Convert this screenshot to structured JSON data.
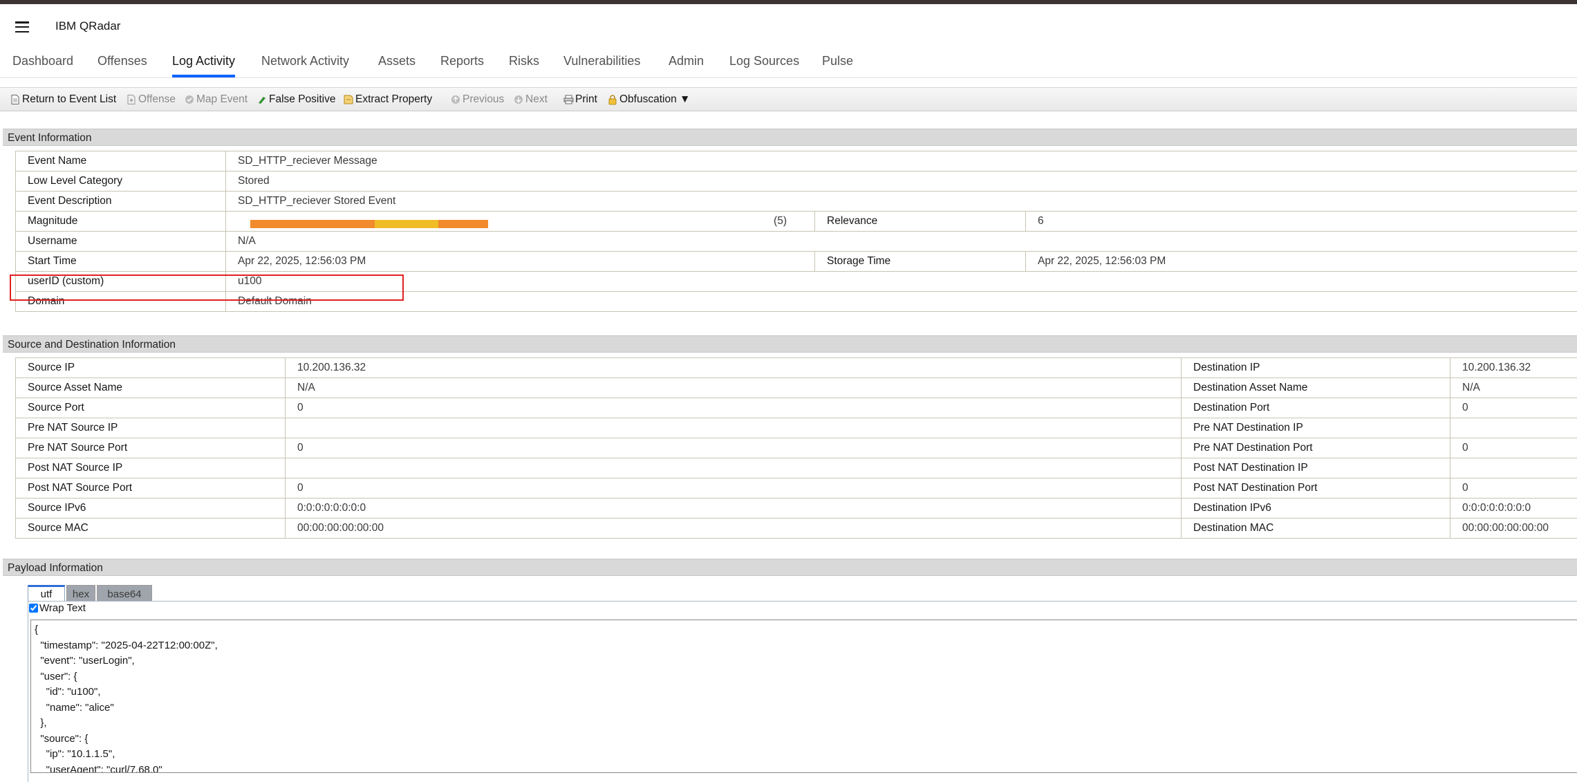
{
  "header": {
    "brand": "IBM QRadar"
  },
  "nav": {
    "tabs": [
      {
        "label": "Dashboard"
      },
      {
        "label": "Offenses"
      },
      {
        "label": "Log Activity"
      },
      {
        "label": "Network Activity"
      },
      {
        "label": "Assets"
      },
      {
        "label": "Reports"
      },
      {
        "label": "Risks"
      },
      {
        "label": "Vulnerabilities"
      },
      {
        "label": "Admin"
      },
      {
        "label": "Log Sources"
      },
      {
        "label": "Pulse"
      }
    ],
    "active": "Log Activity"
  },
  "toolbar": {
    "return_label": "Return to Event List",
    "offense_label": "Offense",
    "map_event_label": "Map Event",
    "false_positive_label": "False Positive",
    "extract_property_label": "Extract Property",
    "previous_label": "Previous",
    "next_label": "Next",
    "print_label": "Print",
    "obfuscation_label": "Obfuscation ▼"
  },
  "event_info": {
    "title": "Event Information",
    "event_name_label": "Event Name",
    "event_name": "SD_HTTP_reciever Message",
    "low_level_category_label": "Low Level Category",
    "low_level_category": "Stored",
    "event_description_label": "Event Description",
    "event_description": "SD_HTTP_reciever Stored Event",
    "magnitude_label": "Magnitude",
    "magnitude": "(5)",
    "relevance_label": "Relevance",
    "relevance": "6",
    "username_label": "Username",
    "username": "N/A",
    "start_time_label": "Start Time",
    "start_time": "Apr 22, 2025, 12:56:03 PM",
    "storage_time_label": "Storage Time",
    "storage_time": "Apr 22, 2025, 12:56:03 PM",
    "userid_label": "userID (custom)",
    "userid": "u100",
    "domain_label": "Domain",
    "domain": "Default Domain"
  },
  "source_dest": {
    "title": "Source and Destination Information",
    "source_ip_label": "Source IP",
    "source_ip": "10.200.136.32",
    "dest_ip_label": "Destination IP",
    "dest_ip": "10.200.136.32",
    "source_asset_label": "Source Asset Name",
    "source_asset": "N/A",
    "dest_asset_label": "Destination Asset Name",
    "dest_asset": "N/A",
    "source_port_label": "Source Port",
    "source_port": "0",
    "dest_port_label": "Destination Port",
    "dest_port": "0",
    "pre_nat_src_ip_label": "Pre NAT Source IP",
    "pre_nat_src_ip": "",
    "pre_nat_dst_ip_label": "Pre NAT Destination IP",
    "pre_nat_dst_ip": "",
    "pre_nat_src_port_label": "Pre NAT Source Port",
    "pre_nat_src_port": "0",
    "pre_nat_dst_port_label": "Pre NAT Destination Port",
    "pre_nat_dst_port": "0",
    "post_nat_src_ip_label": "Post NAT Source IP",
    "post_nat_src_ip": "",
    "post_nat_dst_ip_label": "Post NAT Destination IP",
    "post_nat_dst_ip": "",
    "post_nat_src_port_label": "Post NAT Source Port",
    "post_nat_src_port": "0",
    "post_nat_dst_port_label": "Post NAT Destination Port",
    "post_nat_dst_port": "0",
    "source_ipv6_label": "Source IPv6",
    "source_ipv6": "0:0:0:0:0:0:0:0",
    "dest_ipv6_label": "Destination IPv6",
    "dest_ipv6": "0:0:0:0:0:0:0:0",
    "source_mac_label": "Source MAC",
    "source_mac": "00:00:00:00:00:00",
    "dest_mac_label": "Destination MAC",
    "dest_mac": "00:00:00:00:00:00"
  },
  "payload": {
    "title": "Payload Information",
    "tabs": [
      {
        "label": "utf"
      },
      {
        "label": "hex"
      },
      {
        "label": "base64"
      }
    ],
    "active_tab": "utf",
    "wrap_text_label": "Wrap Text",
    "wrap_text_checked": true,
    "content": "{\n  \"timestamp\": \"2025-04-22T12:00:00Z\",\n  \"event\": \"userLogin\",\n  \"user\": {\n    \"id\": \"u100\",\n    \"name\": \"alice\"\n  },\n  \"source\": {\n    \"ip\": \"10.1.1.5\",\n    \"userAgent\": \"curl/7.68.0\""
  },
  "colors": {
    "accent": "#0f62fe",
    "magnitude_orange": "#f28a2e",
    "magnitude_yellow": "#f0bd27",
    "highlight_red": "#e02020"
  }
}
